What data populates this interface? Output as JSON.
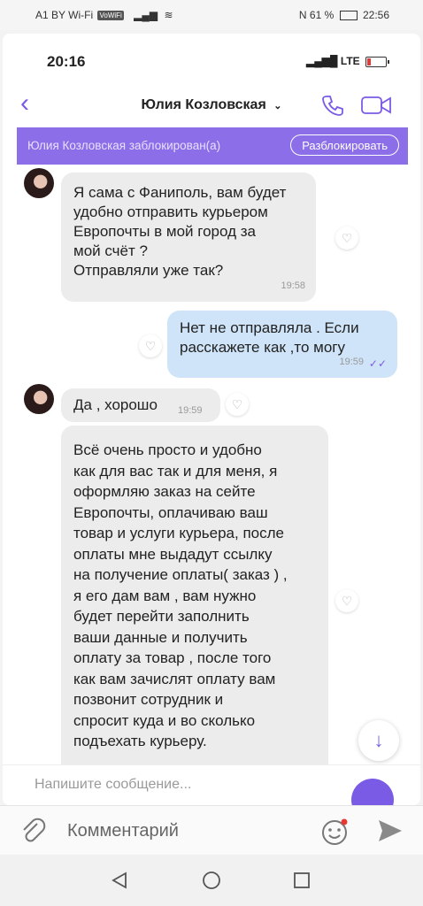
{
  "status_bar": {
    "carrier": "A1 BY Wi-Fi",
    "wifi_badge": "VoWiFi",
    "battery": "61 %",
    "time": "22:56"
  },
  "inner_status": {
    "time": "20:16",
    "network": "LTE"
  },
  "header": {
    "contact_name": "Юлия Козловская"
  },
  "banner": {
    "text": "Юлия Козловская заблокирован(а)",
    "unblock_label": "Разблокировать"
  },
  "messages": [
    {
      "direction": "in",
      "lines": [
        "Я сама с Фаниполь, вам будет",
        "удобно отправить курьером",
        "Европочты в мой город за",
        "мой счёт ?",
        "Отправляли уже так?"
      ],
      "time": "19:58"
    },
    {
      "direction": "out",
      "lines": [
        "Нет не отправляла . Если",
        "расскажете как ,то могу"
      ],
      "time": "19:59"
    },
    {
      "direction": "in",
      "lines": [
        "Да , хорошо"
      ],
      "time": "19:59"
    },
    {
      "direction": "in",
      "lines": [
        "Всё очень просто и удобно",
        "как для вас так и для меня, я",
        "оформляю заказ на сейте",
        "Европочты, оплачиваю ваш",
        "товар и услуги курьера, после",
        "оплаты мне выдадут ссылку",
        "на получение оплаты( заказ ) ,",
        "я его дам вам , вам нужно",
        "будет перейти заполнить",
        "ваши данные и получить",
        "оплату за товар , после того",
        "как вам зачислят оплату вам",
        "позвонит сотрудник и",
        "спросит куда и во сколько",
        "подъехать курьеру."
      ],
      "time": ""
    }
  ],
  "composer": {
    "placeholder": "Напишите сообщение..."
  },
  "comment_bar": {
    "placeholder": "Комментарий"
  },
  "colors": {
    "accent": "#7a5be6",
    "banner": "#8b6ee8",
    "incoming_bubble": "#ececec",
    "outgoing_bubble": "#cfe4f8"
  }
}
